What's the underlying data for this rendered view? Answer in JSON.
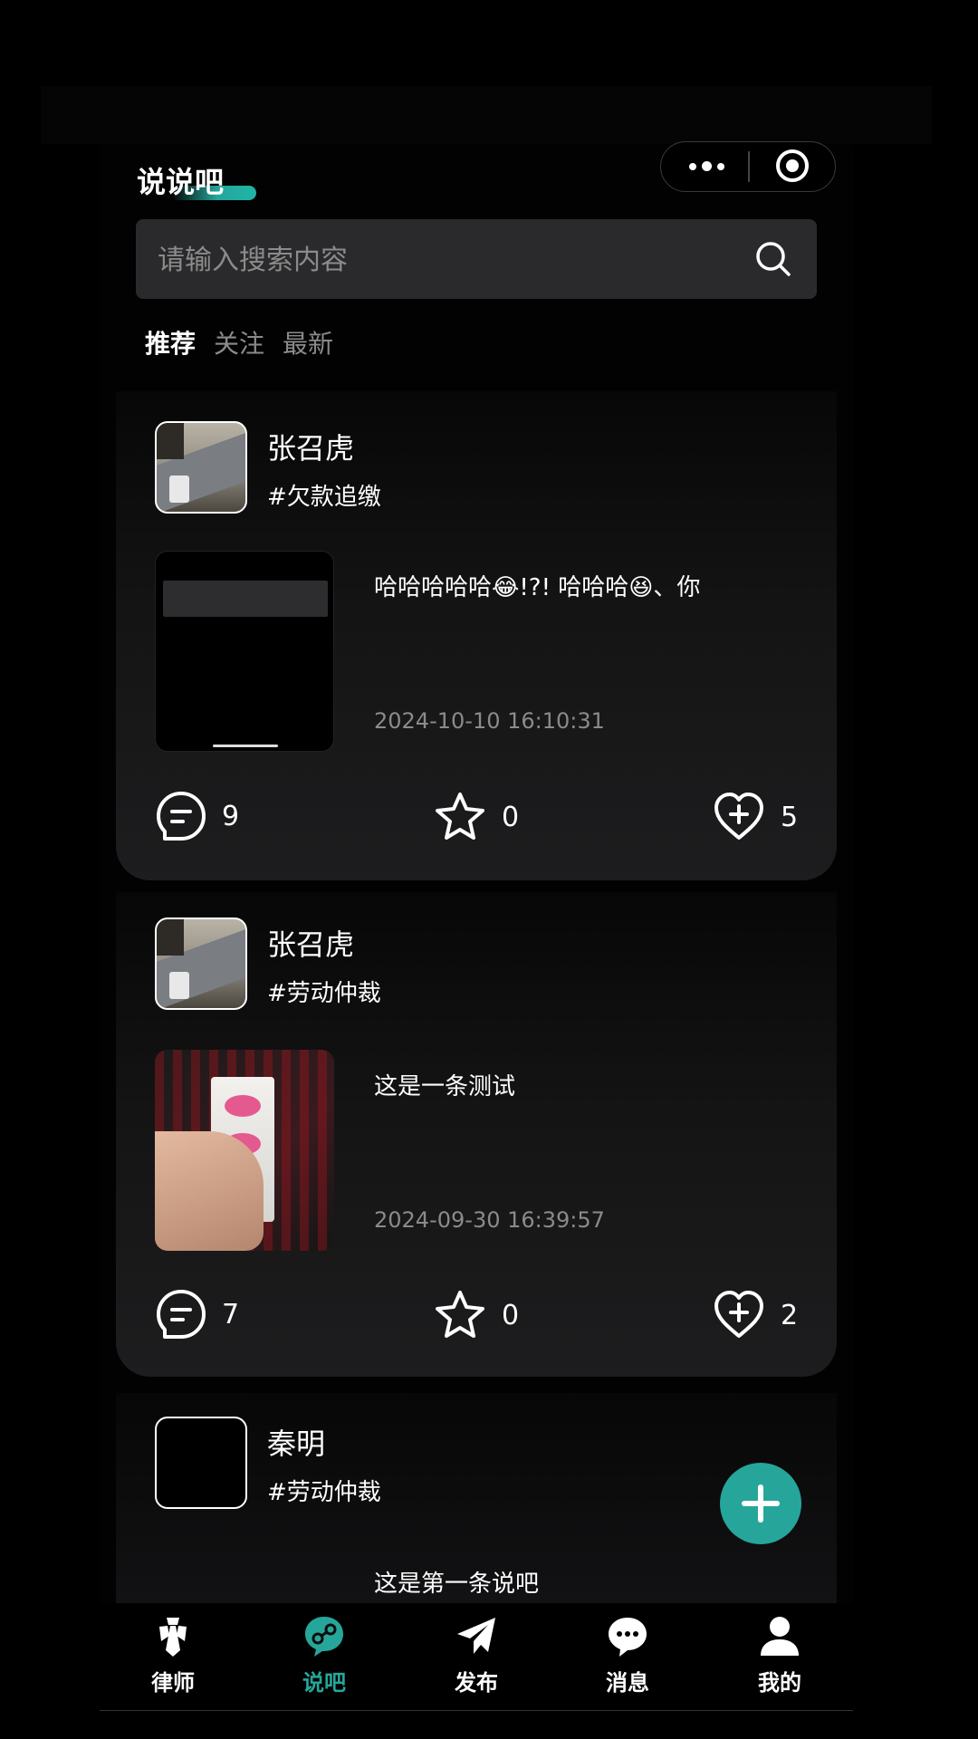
{
  "header": {
    "title": "说说吧"
  },
  "search": {
    "placeholder": "请输入搜索内容"
  },
  "tabs": [
    {
      "label": "推荐",
      "active": true
    },
    {
      "label": "关注",
      "active": false
    },
    {
      "label": "最新",
      "active": false
    }
  ],
  "posts": [
    {
      "author": "张召虎",
      "topic": "#欠款追缴",
      "text": "哈哈哈哈哈😂!?!  哈哈哈😆、你",
      "time": "2024-10-10 16:10:31",
      "comments": "9",
      "favorites": "0",
      "likes": "5"
    },
    {
      "author": "张召虎",
      "topic": "#劳动仲裁",
      "text": "这是一条测试",
      "time": "2024-09-30 16:39:57",
      "comments": "7",
      "favorites": "0",
      "likes": "2"
    },
    {
      "author": "秦明",
      "topic": "#劳动仲裁",
      "text": "这是第一条说吧"
    }
  ],
  "tabbar": [
    {
      "label": "律师",
      "icon": "lawyer-icon"
    },
    {
      "label": "说吧",
      "icon": "talk-icon",
      "active": true
    },
    {
      "label": "发布",
      "icon": "publish-icon"
    },
    {
      "label": "消息",
      "icon": "message-icon"
    },
    {
      "label": "我的",
      "icon": "profile-icon"
    }
  ],
  "colors": {
    "accent": "#26a69a",
    "background": "#000000",
    "card": "#1d1d1f",
    "muted_text": "#8b8b8b"
  }
}
